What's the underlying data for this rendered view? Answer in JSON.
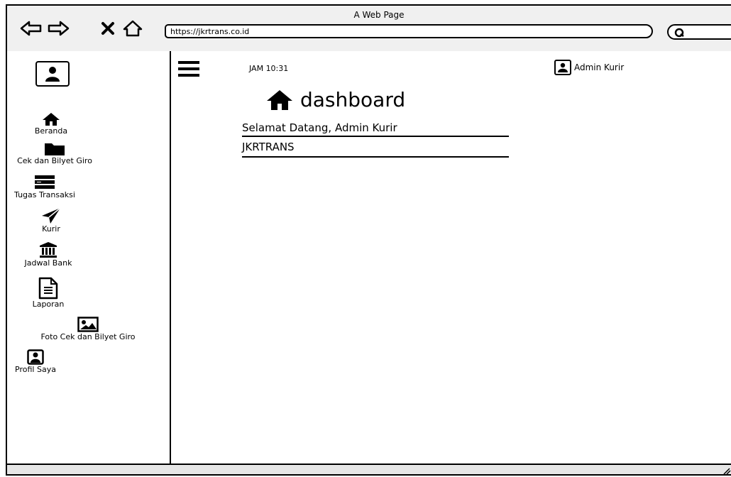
{
  "window": {
    "title": "A Web Page"
  },
  "browser": {
    "url": "https://jkrtrans.co.id"
  },
  "sidebar": {
    "items": [
      {
        "label": "Beranda",
        "icon": "home-icon"
      },
      {
        "label": "Cek dan Bilyet Giro",
        "icon": "folder-icon"
      },
      {
        "label": "Tugas Transaksi",
        "icon": "server-icon"
      },
      {
        "label": "Kurir",
        "icon": "paper-plane-icon"
      },
      {
        "label": "Jadwal Bank",
        "icon": "bank-icon"
      },
      {
        "label": "Laporan",
        "icon": "document-icon"
      },
      {
        "label": "Foto Cek dan Bilyet Giro",
        "icon": "image-icon"
      },
      {
        "label": "Profil Saya",
        "icon": "user-icon"
      }
    ]
  },
  "header": {
    "clock": "JAM 10:31",
    "user_name": "Admin Kurir"
  },
  "main": {
    "title": "dashboard",
    "welcome": "Selamat Datang, Admin Kurir",
    "company": "JKRTRANS"
  }
}
